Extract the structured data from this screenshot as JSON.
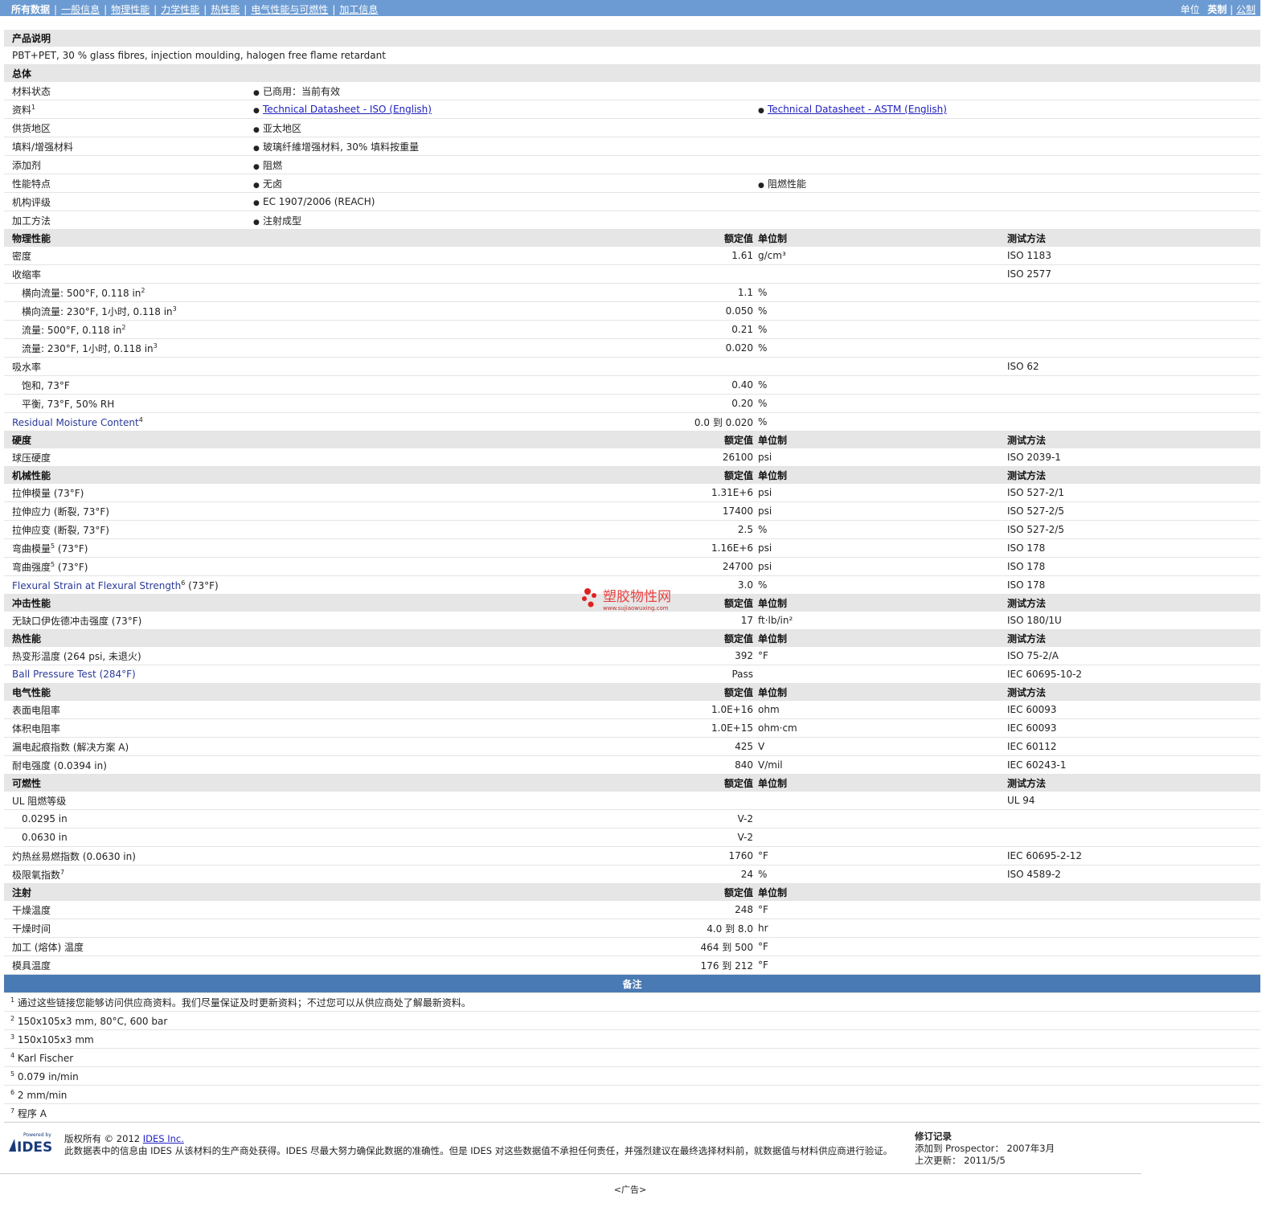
{
  "nav": {
    "items": [
      "所有数据",
      "一般信息",
      "物理性能",
      "力学性能",
      "热性能",
      "电气性能与可燃性",
      "加工信息"
    ],
    "units_label": "单位",
    "imperial": "英制",
    "metric": "公制"
  },
  "product": {
    "header": "产品说明",
    "description": "PBT+PET, 30 % glass fibres, injection moulding, halogen free flame retardant"
  },
  "general": {
    "header": "总体",
    "rows": [
      {
        "label": "材料状态",
        "values": [
          "已商用：当前有效"
        ]
      },
      {
        "label": "资料",
        "sup": "1",
        "links": [
          "Technical Datasheet - ISO (English)",
          "Technical Datasheet - ASTM (English)"
        ]
      },
      {
        "label": "供货地区",
        "values": [
          "亚太地区"
        ]
      },
      {
        "label": "填料/增强材料",
        "values": [
          "玻璃纤維增强材料, 30% 填料按重量"
        ]
      },
      {
        "label": "添加剂",
        "values": [
          "阻燃"
        ]
      },
      {
        "label": "性能特点",
        "values": [
          "无卤",
          "阻燃性能"
        ]
      },
      {
        "label": "机构评级",
        "values": [
          "EC 1907/2006 (REACH)"
        ]
      },
      {
        "label": "加工方法",
        "values": [
          "注射成型"
        ]
      }
    ]
  },
  "col_headers": {
    "nominal": "额定值",
    "unit": "单位制",
    "test": "测试方法"
  },
  "sections": [
    {
      "title": "物理性能",
      "test_col": true,
      "rows": [
        {
          "label": "密度",
          "value": "1.61",
          "unit": "g/cm³",
          "test": "ISO 1183"
        },
        {
          "label": "收缩率",
          "value": "",
          "unit": "",
          "test": "ISO 2577"
        },
        {
          "label": "横向流量: 500°F, 0.118 in",
          "sup": "2",
          "indent": true,
          "value": "1.1",
          "unit": "%",
          "test": ""
        },
        {
          "label": "横向流量: 230°F, 1小时, 0.118 in",
          "sup": "3",
          "indent": true,
          "value": "0.050",
          "unit": "%",
          "test": ""
        },
        {
          "label": "流量: 500°F, 0.118 in",
          "sup": "2",
          "indent": true,
          "value": "0.21",
          "unit": "%",
          "test": ""
        },
        {
          "label": "流量: 230°F, 1小时, 0.118 in",
          "sup": "3",
          "indent": true,
          "value": "0.020",
          "unit": "%",
          "test": ""
        },
        {
          "label": "吸水率",
          "value": "",
          "unit": "",
          "test": "ISO 62"
        },
        {
          "label": "饱和, 73°F",
          "indent": true,
          "value": "0.40",
          "unit": "%",
          "test": ""
        },
        {
          "label": "平衡, 73°F, 50% RH",
          "indent": true,
          "value": "0.20",
          "unit": "%",
          "test": ""
        },
        {
          "label": "Residual Moisture Content",
          "sup": "4",
          "link": true,
          "value": "0.0 到  0.020",
          "unit": "%",
          "test": ""
        }
      ]
    },
    {
      "title": "硬度",
      "test_col": true,
      "rows": [
        {
          "label": "球压硬度",
          "value": "26100",
          "unit": "psi",
          "test": "ISO 2039-1"
        }
      ]
    },
    {
      "title": "机械性能",
      "test_col": true,
      "rows": [
        {
          "label": "拉伸模量 (73°F)",
          "value": "1.31E+6",
          "unit": "psi",
          "test": "ISO 527-2/1"
        },
        {
          "label": "拉伸应力 (断裂, 73°F)",
          "value": "17400",
          "unit": "psi",
          "test": "ISO 527-2/5"
        },
        {
          "label": "拉伸应变 (断裂, 73°F)",
          "value": "2.5",
          "unit": "%",
          "test": "ISO 527-2/5"
        },
        {
          "label": "弯曲模量",
          "sup": "5",
          "suffix": " (73°F)",
          "value": "1.16E+6",
          "unit": "psi",
          "test": "ISO 178"
        },
        {
          "label": "弯曲强度",
          "sup": "5",
          "suffix": " (73°F)",
          "value": "24700",
          "unit": "psi",
          "test": "ISO 178"
        },
        {
          "label": "Flexural Strain at Flexural Strength",
          "sup": "6",
          "suffix": " (73°F)",
          "link": true,
          "value": "3.0",
          "unit": "%",
          "test": "ISO 178"
        }
      ]
    },
    {
      "title": "冲击性能",
      "test_col": true,
      "rows": [
        {
          "label": "无缺口伊佐德冲击强度 (73°F)",
          "value": "17",
          "unit": "ft·lb/in²",
          "test": "ISO 180/1U"
        }
      ]
    },
    {
      "title": "热性能",
      "test_col": true,
      "rows": [
        {
          "label": "热变形温度 (264 psi, 未退火)",
          "value": "392",
          "unit": "°F",
          "test": "ISO 75-2/A"
        },
        {
          "label": "Ball Pressure Test (284°F)",
          "link": true,
          "value": "Pass",
          "unit": "",
          "test": "IEC 60695-10-2"
        }
      ]
    },
    {
      "title": "电气性能",
      "test_col": true,
      "rows": [
        {
          "label": "表面电阻率",
          "value": "1.0E+16",
          "unit": "ohm",
          "test": "IEC 60093"
        },
        {
          "label": "体积电阻率",
          "value": "1.0E+15",
          "unit": "ohm·cm",
          "test": "IEC 60093"
        },
        {
          "label": "漏电起痕指数 (解决方案 A)",
          "value": "425",
          "unit": "V",
          "test": "IEC 60112"
        },
        {
          "label": "耐电强度 (0.0394 in)",
          "value": "840",
          "unit": "V/mil",
          "test": "IEC 60243-1"
        }
      ]
    },
    {
      "title": "可燃性",
      "test_col": true,
      "rows": [
        {
          "label": "UL 阻燃等级",
          "value": "",
          "unit": "",
          "test": "UL 94"
        },
        {
          "label": "0.0295 in",
          "indent": true,
          "value": "V-2",
          "unit": "",
          "test": ""
        },
        {
          "label": "0.0630 in",
          "indent": true,
          "value": "V-2",
          "unit": "",
          "test": ""
        },
        {
          "label": "灼热丝易燃指数 (0.0630 in)",
          "value": "1760",
          "unit": "°F",
          "test": "IEC 60695-2-12"
        },
        {
          "label": "极限氧指数",
          "sup": "7",
          "value": "24",
          "unit": "%",
          "test": "ISO 4589-2"
        }
      ]
    },
    {
      "title": "注射",
      "test_col": false,
      "rows": [
        {
          "label": "干燥温度",
          "value": "248",
          "unit": "°F",
          "test": ""
        },
        {
          "label": "干燥时间",
          "value": "4.0 到  8.0",
          "unit": "hr",
          "test": ""
        },
        {
          "label": "加工 (熔体) 温度",
          "value": "464 到  500",
          "unit": "°F",
          "test": ""
        },
        {
          "label": "模具温度",
          "value": "176 到  212",
          "unit": "°F",
          "test": ""
        }
      ]
    }
  ],
  "remarks": {
    "header": "备注",
    "items": [
      {
        "n": "1",
        "text": "通过这些链接您能够访问供应商资料。我们尽量保证及时更新资料；不过您可以从供应商处了解最新资料。"
      },
      {
        "n": "2",
        "text": "150x105x3 mm, 80°C, 600 bar"
      },
      {
        "n": "3",
        "text": "150x105x3 mm"
      },
      {
        "n": "4",
        "text": "Karl Fischer"
      },
      {
        "n": "5",
        "text": "0.079 in/min"
      },
      {
        "n": "6",
        "text": "2 mm/min"
      },
      {
        "n": "7",
        "text": "程序 A"
      }
    ]
  },
  "footer": {
    "logo_top": "Powered by",
    "logo_text": "IDES",
    "copyright_prefix": "版权所有 © 2012",
    "copyright_link": "IDES Inc.",
    "disclaimer": "此数据表中的信息由 IDES 从该材料的生产商处获得。IDES 尽最大努力确保此数据的准确性。但是 IDES 对这些数据值不承担任何责任，并强烈建议在最终选择材料前，就数据值与材料供应商进行验证。",
    "rev_title": "修订记录",
    "added_label": "添加到 Prospector：",
    "added_value": "2007年3月",
    "updated_label": "上次更新：",
    "updated_value": "2011/5/5"
  },
  "ad": "<广告>",
  "watermark": {
    "title": "塑胶物性网",
    "url": "www.sujiaowuxing.com"
  }
}
